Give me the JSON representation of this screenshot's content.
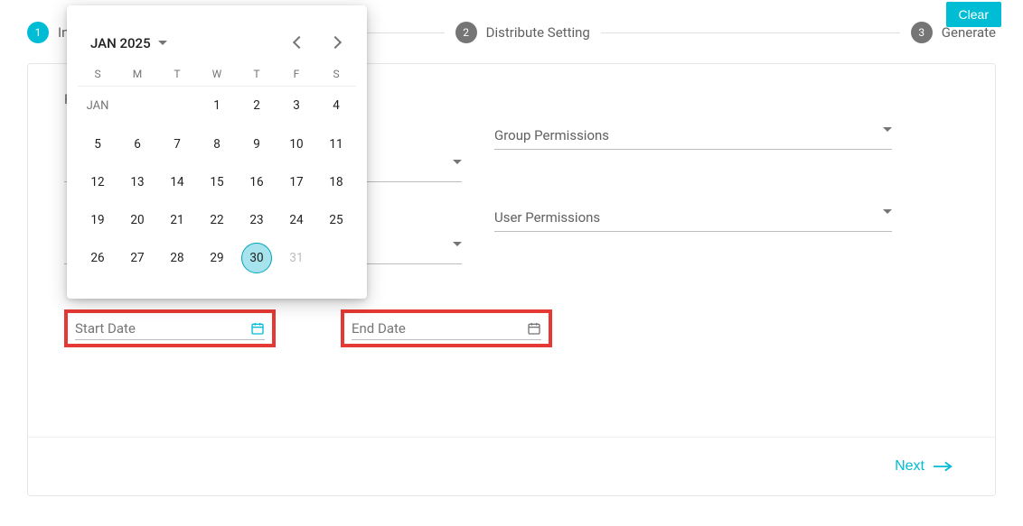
{
  "clear_label": "Clear",
  "steps": [
    {
      "num": "1",
      "label": "Input Setting",
      "active": true
    },
    {
      "num": "2",
      "label": "Distribute Setting",
      "active": false
    },
    {
      "num": "3",
      "label": "Generate",
      "active": false
    }
  ],
  "card": {
    "section_label": "Re",
    "selects": {
      "group_permissions": "Group Permissions",
      "user_permissions": "User Permissions"
    },
    "start_date_ph": "Start Date",
    "end_date_ph": "End Date",
    "next_label": "Next"
  },
  "datepicker": {
    "month_year": "JAN 2025",
    "month_short": "JAN",
    "dow": [
      "S",
      "M",
      "T",
      "W",
      "T",
      "F",
      "S"
    ],
    "weeks": [
      [
        null,
        null,
        null,
        1,
        2,
        3,
        4
      ],
      [
        5,
        6,
        7,
        8,
        9,
        10,
        11
      ],
      [
        12,
        13,
        14,
        15,
        16,
        17,
        18
      ],
      [
        19,
        20,
        21,
        22,
        23,
        24,
        25
      ],
      [
        26,
        27,
        28,
        29,
        30,
        31,
        null
      ]
    ],
    "selected": 30,
    "disabled": [
      31
    ]
  }
}
